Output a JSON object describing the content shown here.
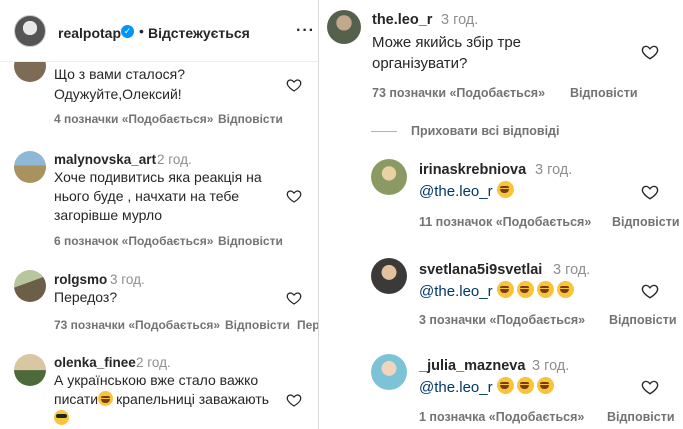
{
  "header": {
    "username": "realpotap",
    "verified_symbol": "✓",
    "follow_status": "Відстежується",
    "more_symbol": "···"
  },
  "reply_label": "Відповісти",
  "left_comments": [
    {
      "username": "",
      "time": "",
      "lines": [
        "Що з вами сталося?",
        "Одужуйте,Олексий!"
      ],
      "likes": "4 позначки «Подобається»"
    },
    {
      "username": "malynovska_art",
      "time": "2 год.",
      "lines": [
        "Хоче подивитись яка реакція на",
        "нього буде , начхати на тебе",
        "загорівше мурло"
      ],
      "likes": "6 позначок «Подобається»"
    },
    {
      "username": "rolgsmo",
      "time": "3 год.",
      "lines": [
        "Передоз?"
      ],
      "likes": "73 позначки «Подобається»",
      "extra": "Пер"
    },
    {
      "username": "olenka_finee",
      "time": "2 год.",
      "lines": [
        "А українською вже стало важко",
        "писати",
        "крапельниці заважають"
      ],
      "likes": ""
    }
  ],
  "right_comments": [
    {
      "username": "the.leo_r",
      "time": "3 год.",
      "lines": [
        "Може якийсь збір тре",
        "організувати?"
      ],
      "likes": "73 позначки «Подобається»"
    },
    {
      "username": "irinaskrebniova",
      "time": "3 год.",
      "mention": "@the.leo_r",
      "emoji_count": 1,
      "likes": "11 позначок «Подобається»"
    },
    {
      "username": "svetlana5i9svetlai",
      "time": "3 год.",
      "mention": "@the.leo_r",
      "emoji_count": 4,
      "likes": "3 позначки «Подобається»"
    },
    {
      "username": "_julia_mazneva",
      "time": "3 год.",
      "mention": "@the.leo_r",
      "emoji_count": 3,
      "likes": "1 позначка «Подобається»"
    }
  ],
  "hide_replies": "Приховати всі відповіді",
  "colors": {
    "verified": "#0095f6",
    "mention": "#00376b",
    "meta": "#737373"
  }
}
